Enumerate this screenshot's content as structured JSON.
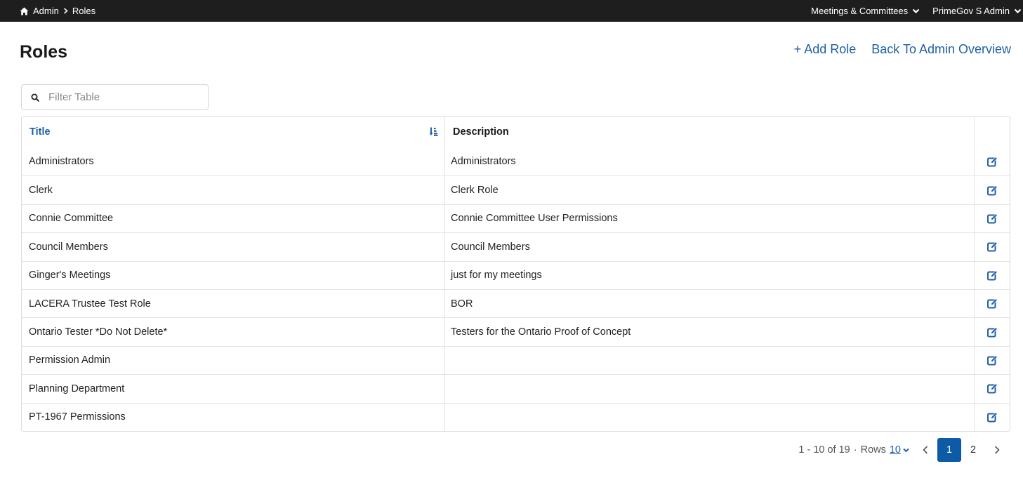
{
  "topbar": {
    "breadcrumb": [
      {
        "label": "Admin"
      },
      {
        "label": "Roles"
      }
    ],
    "menus": [
      {
        "label": "Meetings & Committees"
      },
      {
        "label": "PrimeGov S Admin"
      }
    ]
  },
  "header": {
    "title": "Roles",
    "add_role": "+ Add Role",
    "back": "Back To Admin Overview"
  },
  "filter": {
    "placeholder": "Filter Table",
    "value": ""
  },
  "table": {
    "columns": {
      "title": "Title",
      "description": "Description"
    },
    "rows": [
      {
        "title": "Administrators",
        "description": "Administrators"
      },
      {
        "title": "Clerk",
        "description": "Clerk Role"
      },
      {
        "title": "Connie Committee",
        "description": "Connie Committee User Permissions"
      },
      {
        "title": "Council Members",
        "description": "Council Members"
      },
      {
        "title": "Ginger's Meetings",
        "description": "just for my meetings"
      },
      {
        "title": "LACERA Trustee Test Role",
        "description": "BOR"
      },
      {
        "title": "Ontario Tester *Do Not Delete*",
        "description": "Testers for the Ontario Proof of Concept"
      },
      {
        "title": "Permission Admin",
        "description": ""
      },
      {
        "title": "Planning Department",
        "description": ""
      },
      {
        "title": "PT-1967 Permissions",
        "description": ""
      }
    ]
  },
  "pagination": {
    "range": "1 - 10 of 19",
    "rows_label": "Rows",
    "rows_value": "10",
    "pages": [
      "1",
      "2"
    ],
    "current": "1"
  },
  "colors": {
    "accent": "#1f5fa8",
    "topbar": "#1e1e1e",
    "active_page": "#0d5aa7"
  }
}
